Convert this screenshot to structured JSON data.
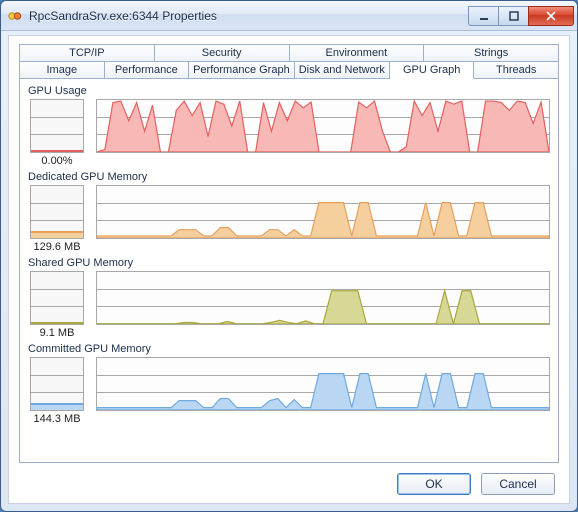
{
  "window": {
    "title": "RpcSandraSrv.exe:6344 Properties"
  },
  "tabs": {
    "row1": [
      "TCP/IP",
      "Security",
      "Environment",
      "Strings"
    ],
    "row2": [
      "Image",
      "Performance",
      "Performance Graph",
      "Disk and Network",
      "GPU Graph",
      "Threads"
    ],
    "active": "GPU Graph"
  },
  "sections": {
    "gpu_usage": {
      "title": "GPU Usage",
      "value": "0.00%",
      "color_line": "#e4605e",
      "color_fill": "#f7b8b6",
      "thumb_pct": 0
    },
    "dedicated": {
      "title": "Dedicated GPU Memory",
      "value": "129.6 MB",
      "color_line": "#e6a05a",
      "color_fill": "#f6cf9f",
      "thumb_pct": 14
    },
    "shared": {
      "title": "Shared GPU Memory",
      "value": "9.1 MB",
      "color_line": "#a8a83b",
      "color_fill": "#d8d896",
      "thumb_pct": 4
    },
    "committed": {
      "title": "Committed GPU Memory",
      "value": "144.3 MB",
      "color_line": "#6fa9e0",
      "color_fill": "#b9d6f3",
      "thumb_pct": 14
    }
  },
  "buttons": {
    "ok": "OK",
    "cancel": "Cancel"
  },
  "chart_data": [
    {
      "type": "area",
      "name": "GPU Usage",
      "ylabel": "%",
      "ylim": [
        0,
        100
      ],
      "values": [
        0,
        5,
        95,
        98,
        60,
        95,
        40,
        90,
        0,
        0,
        80,
        98,
        70,
        95,
        30,
        98,
        92,
        50,
        98,
        0,
        0,
        95,
        40,
        95,
        60,
        98,
        85,
        96,
        0,
        0,
        0,
        0,
        0,
        96,
        85,
        98,
        40,
        0,
        0,
        10,
        98,
        70,
        95,
        40,
        98,
        92,
        98,
        0,
        0,
        98,
        98,
        95,
        80,
        98,
        95,
        55,
        96,
        0
      ]
    },
    {
      "type": "area",
      "name": "Dedicated GPU Memory",
      "ylabel": "MB",
      "ylim": [
        0,
        1000
      ],
      "values": [
        40,
        40,
        40,
        40,
        40,
        40,
        40,
        40,
        40,
        40,
        160,
        160,
        160,
        40,
        40,
        200,
        200,
        40,
        40,
        40,
        40,
        160,
        160,
        40,
        160,
        40,
        40,
        680,
        680,
        680,
        680,
        40,
        680,
        680,
        40,
        40,
        40,
        40,
        40,
        40,
        680,
        40,
        680,
        680,
        40,
        40,
        680,
        680,
        40,
        40,
        40,
        40,
        40,
        40,
        40,
        40
      ]
    },
    {
      "type": "area",
      "name": "Shared GPU Memory",
      "ylabel": "MB",
      "ylim": [
        0,
        1000
      ],
      "values": [
        5,
        5,
        5,
        5,
        5,
        5,
        5,
        5,
        5,
        5,
        30,
        30,
        5,
        5,
        5,
        50,
        5,
        5,
        5,
        5,
        30,
        70,
        30,
        5,
        60,
        5,
        5,
        640,
        640,
        640,
        640,
        5,
        5,
        5,
        5,
        5,
        5,
        5,
        5,
        5,
        640,
        5,
        640,
        640,
        5,
        5,
        5,
        5,
        5,
        5,
        5,
        5,
        5
      ]
    },
    {
      "type": "area",
      "name": "Committed GPU Memory",
      "ylabel": "MB",
      "ylim": [
        0,
        1000
      ],
      "values": [
        45,
        45,
        45,
        45,
        45,
        45,
        45,
        45,
        45,
        45,
        180,
        180,
        180,
        45,
        45,
        220,
        220,
        45,
        45,
        45,
        45,
        180,
        220,
        45,
        200,
        45,
        45,
        700,
        700,
        700,
        700,
        45,
        700,
        700,
        45,
        45,
        45,
        45,
        45,
        45,
        700,
        45,
        700,
        700,
        45,
        45,
        700,
        700,
        45,
        45,
        45,
        45,
        45,
        45,
        45,
        45
      ]
    }
  ]
}
